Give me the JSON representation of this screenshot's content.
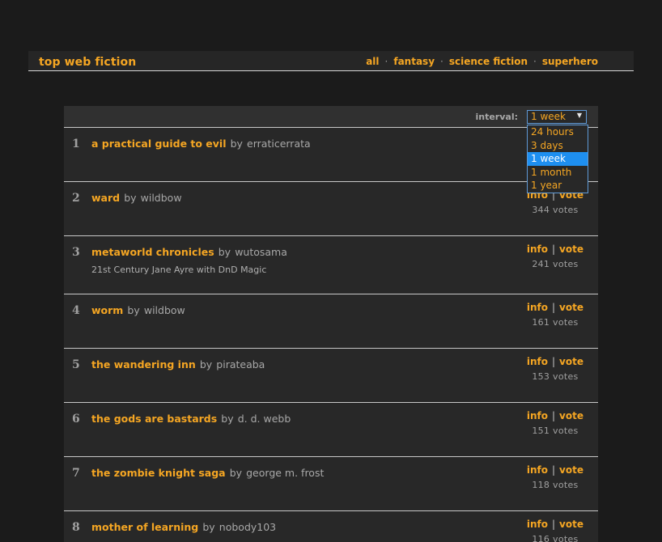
{
  "site": {
    "title": "top web fiction"
  },
  "nav": {
    "items": [
      "all",
      "fantasy",
      "science fiction",
      "superhero"
    ],
    "separator": "·"
  },
  "toolbar": {
    "interval_label": "interval:",
    "interval_value": "1 week"
  },
  "interval_options": [
    "24 hours",
    "3 days",
    "1 week",
    "1 month",
    "1 year"
  ],
  "interval_selected_index": 2,
  "row_actions": {
    "info": "info",
    "vote": "vote",
    "pipe": "|",
    "by": "by"
  },
  "rows": [
    {
      "rank": "1",
      "title": "a practical guide to evil",
      "author": "erraticerrata",
      "subtitle": "",
      "votes": ""
    },
    {
      "rank": "2",
      "title": "ward",
      "author": "wildbow",
      "subtitle": "",
      "votes": "344 votes"
    },
    {
      "rank": "3",
      "title": "metaworld chronicles",
      "author": "wutosama",
      "subtitle": "21st Century Jane Ayre with DnD Magic",
      "votes": "241 votes"
    },
    {
      "rank": "4",
      "title": "worm",
      "author": "wildbow",
      "subtitle": "",
      "votes": "161 votes"
    },
    {
      "rank": "5",
      "title": "the wandering inn",
      "author": "pirateaba",
      "subtitle": "",
      "votes": "153 votes"
    },
    {
      "rank": "6",
      "title": "the gods are bastards",
      "author": "d. d. webb",
      "subtitle": "",
      "votes": "151 votes"
    },
    {
      "rank": "7",
      "title": "the zombie knight saga",
      "author": "george m. frost",
      "subtitle": "",
      "votes": "118 votes"
    },
    {
      "rank": "8",
      "title": "mother of learning",
      "author": "nobody103",
      "subtitle": "",
      "votes": "116 votes"
    }
  ],
  "colors": {
    "accent": "#f5a623",
    "background": "#1b1b1b",
    "panel": "#282828",
    "selected_option": "#1e8ff0"
  }
}
